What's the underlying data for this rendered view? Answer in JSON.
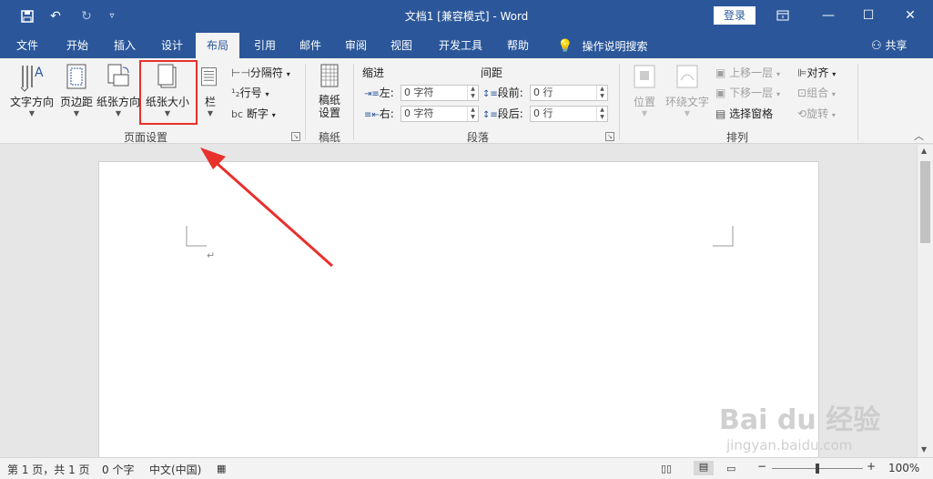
{
  "titlebar": {
    "title": "文档1 [兼容模式] - Word",
    "login": "登录",
    "qat_icons": [
      "save-icon",
      "undo-icon",
      "redo-icon",
      "customize-icon"
    ],
    "window_buttons": [
      "ribbon-display-icon",
      "minimize-icon",
      "maximize-icon",
      "close-icon"
    ]
  },
  "tabs": [
    "文件",
    "开始",
    "插入",
    "设计",
    "布局",
    "引用",
    "邮件",
    "审阅",
    "视图",
    "开发工具",
    "帮助"
  ],
  "active_tab": "布局",
  "tell_me": "操作说明搜索",
  "share": "共享",
  "ribbon": {
    "page_setup": {
      "label": "页面设置",
      "text_direction": "文字方向",
      "margins": "页边距",
      "orientation": "纸张方向",
      "size": "纸张大小",
      "columns": "栏",
      "breaks": "分隔符",
      "line_numbers": "行号",
      "hyphenation": "断字"
    },
    "manuscript": {
      "label": "稿纸",
      "setup_line1": "稿纸",
      "setup_line2": "设置"
    },
    "paragraph": {
      "label": "段落",
      "indent_header": "缩进",
      "spacing_header": "间距",
      "left_label": "左:",
      "right_label": "右:",
      "before_label": "段前:",
      "after_label": "段后:",
      "left_value": "0 字符",
      "right_value": "0 字符",
      "before_value": "0 行",
      "after_value": "0 行"
    },
    "arrange": {
      "label": "排列",
      "position": "位置",
      "wrap_text": "环绕文字",
      "bring_forward": "上移一层",
      "send_backward": "下移一层",
      "selection_pane": "选择窗格",
      "align": "对齐",
      "group": "组合",
      "rotate": "旋转"
    }
  },
  "document": {
    "paragraph_mark": "↵"
  },
  "statusbar": {
    "page": "第 1 页，共 1 页",
    "words": "0 个字",
    "language": "中文(中国)",
    "zoom": "100%"
  },
  "watermark": {
    "brand": "Bai du 经验",
    "url": "jingyan.baidu.com"
  },
  "colors": {
    "brand": "#2b579a",
    "highlight": "#e8302c"
  }
}
